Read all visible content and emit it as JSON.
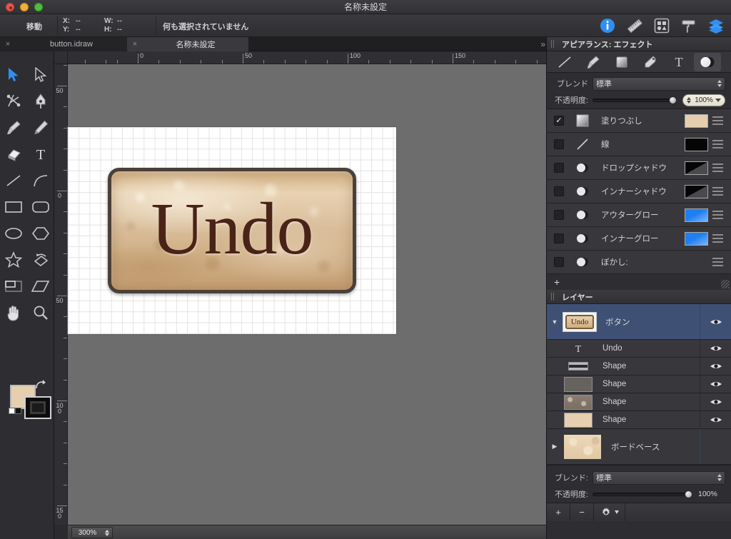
{
  "window": {
    "title": "名称未設定",
    "traffic_lights": [
      "close-red",
      "minimize-yellow",
      "zoom-green"
    ]
  },
  "toolbar": {
    "mode_label": "移動",
    "coords": [
      {
        "key": "X:",
        "value": "--"
      },
      {
        "key": "Y:",
        "value": "--"
      },
      {
        "key": "W:",
        "value": "--"
      },
      {
        "key": "H:",
        "value": "--"
      }
    ],
    "status": "何も選択されていません",
    "icons": [
      "info-icon",
      "ruler-icon",
      "shapes-icon",
      "paint-roller-icon",
      "layers-icon"
    ]
  },
  "tabs": {
    "items": [
      {
        "label": "button.idraw",
        "active": false,
        "close": "×"
      },
      {
        "label": "名称未設定",
        "active": true,
        "close": "×"
      }
    ],
    "overflow": "»"
  },
  "tools": {
    "items": [
      {
        "name": "select-arrow-tool",
        "selected": true
      },
      {
        "name": "direct-select-tool",
        "selected": false
      },
      {
        "name": "node-edit-tool",
        "selected": false
      },
      {
        "name": "pen-tool",
        "selected": false
      },
      {
        "name": "brush-tool",
        "selected": false
      },
      {
        "name": "pencil-tool",
        "selected": false
      },
      {
        "name": "eraser-tool",
        "selected": false
      },
      {
        "name": "text-tool",
        "selected": false
      },
      {
        "name": "line-tool",
        "selected": false
      },
      {
        "name": "arc-tool",
        "selected": false
      },
      {
        "name": "rectangle-tool",
        "selected": false
      },
      {
        "name": "rounded-rectangle-tool",
        "selected": false
      },
      {
        "name": "ellipse-tool",
        "selected": false
      },
      {
        "name": "polygon-tool",
        "selected": false
      },
      {
        "name": "star-tool",
        "selected": false
      },
      {
        "name": "rotate-tool",
        "selected": false
      },
      {
        "name": "crop-tool",
        "selected": false
      },
      {
        "name": "shear-tool",
        "selected": false
      },
      {
        "name": "hand-tool",
        "selected": false
      },
      {
        "name": "zoom-tool",
        "selected": false
      }
    ],
    "fill_color": "#e6cfae",
    "stroke_color": "#0c0c0c"
  },
  "rulers": {
    "horizontal_labels": [
      "0",
      "50",
      "100",
      "150"
    ],
    "vertical_labels": [
      "50",
      "0",
      "50",
      "100",
      "150"
    ],
    "unit_spacing": 49
  },
  "canvas": {
    "artwork_label": "Undo",
    "button_fill": "#dcc2a0",
    "button_border": "#4a4038",
    "text_color": "#4a2318",
    "grid": true
  },
  "statusbar": {
    "zoom": "300%"
  },
  "appearance": {
    "panel_title": "アピアランス: エフェクト",
    "tabs": [
      {
        "name": "stroke-tab",
        "selected": false
      },
      {
        "name": "brush-tab",
        "selected": false
      },
      {
        "name": "fill-tab",
        "selected": false
      },
      {
        "name": "eyedropper-tab",
        "selected": false
      },
      {
        "name": "text-tab",
        "selected": false
      },
      {
        "name": "effects-tab",
        "selected": true
      }
    ],
    "blend_label": "ブレンド",
    "blend_value": "標準",
    "opacity_label": "不透明度:",
    "opacity_value": "100%",
    "effects": [
      {
        "name": "塗りつぶし",
        "checked": true,
        "icon": "gradient-square-icon",
        "swatch": "tan",
        "has_swatch": true
      },
      {
        "name": "線",
        "checked": false,
        "icon": "diagonal-line-icon",
        "swatch": "black",
        "has_swatch": true
      },
      {
        "name": "ドロップシャドウ",
        "checked": false,
        "icon": "sphere-icon",
        "swatch": "black-gray-diagonal",
        "has_swatch": true
      },
      {
        "name": "インナーシャドウ",
        "checked": false,
        "icon": "sphere-icon",
        "swatch": "black-gray-diagonal",
        "has_swatch": true
      },
      {
        "name": "アウターグロー",
        "checked": false,
        "icon": "sphere-icon",
        "swatch": "blue-gradient",
        "has_swatch": true
      },
      {
        "name": "インナーグロー",
        "checked": false,
        "icon": "sphere-icon",
        "swatch": "blue-gradient",
        "has_swatch": true
      },
      {
        "name": "ぼかし:",
        "checked": false,
        "icon": "sphere-icon",
        "swatch": "",
        "has_swatch": false
      }
    ],
    "add_label": "+"
  },
  "layers": {
    "panel_title": "レイヤー",
    "items": [
      {
        "label": "ボタン",
        "type": "group",
        "selected": true,
        "expanded": true,
        "thumb": "undo-button",
        "thumb_text": "Undo"
      },
      {
        "label": "Undo",
        "type": "text",
        "selected": false,
        "thumb": "text-T"
      },
      {
        "label": "Shape",
        "type": "shape",
        "selected": false,
        "thumb": "dark-bar"
      },
      {
        "label": "Shape",
        "type": "shape",
        "selected": false,
        "thumb": "gray-fill"
      },
      {
        "label": "Shape",
        "type": "shape",
        "selected": false,
        "thumb": "texture-fill"
      },
      {
        "label": "Shape",
        "type": "shape",
        "selected": false,
        "thumb": "tan-fill"
      },
      {
        "label": "ボードベース",
        "type": "group",
        "selected": false,
        "expanded": false,
        "thumb": "paper-texture"
      }
    ],
    "blend_label": "ブレンド:",
    "blend_value": "標準",
    "opacity_label": "不透明度:",
    "opacity_value": "100%",
    "footer_buttons": [
      {
        "name": "add-layer-button",
        "label": "+"
      },
      {
        "name": "remove-layer-button",
        "label": "−"
      },
      {
        "name": "layer-options-button",
        "label": "gear"
      }
    ]
  }
}
